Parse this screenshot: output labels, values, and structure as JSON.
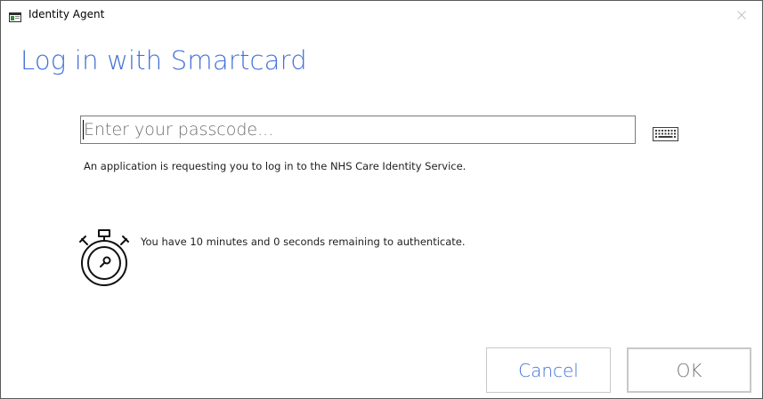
{
  "window": {
    "title": "Identity Agent"
  },
  "main": {
    "heading": "Log in with Smartcard",
    "passcode_placeholder": "Enter your passcode...",
    "passcode_value": "",
    "info_text": "An application is requesting you to log in to the NHS Care Identity Service.",
    "timer_text": "You have 10 minutes and 0 seconds remaining to authenticate."
  },
  "buttons": {
    "cancel_label": "Cancel",
    "ok_label": "OK"
  },
  "icons": {
    "app": "app-window-icon",
    "close": "close-icon",
    "keyboard": "keyboard-icon",
    "stopwatch": "stopwatch-icon"
  },
  "colors": {
    "accent": "#4472d6",
    "border": "#c8c8c8"
  }
}
